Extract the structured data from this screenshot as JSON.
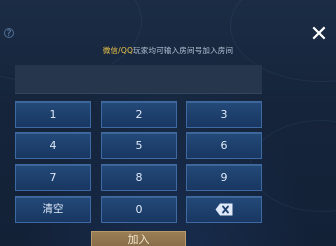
{
  "dialog": {
    "hint_highlight": "微信/QQ",
    "hint_rest": "玩家均可输入房间号加入房间",
    "room_number_value": "",
    "close_icon": "close-icon",
    "corner_icon": "help-icon"
  },
  "keypad": {
    "keys": [
      "1",
      "2",
      "3",
      "4",
      "5",
      "6",
      "7",
      "8",
      "9",
      "清空",
      "0"
    ],
    "delete_icon": "backspace-icon"
  },
  "actions": {
    "join_label": "加入"
  },
  "colors": {
    "background": "#142237",
    "key_fill": "#1d3f6c",
    "key_border": "#3d6aa2",
    "hint_highlight": "#f0c84a",
    "join_button": "#8a6f4b"
  }
}
